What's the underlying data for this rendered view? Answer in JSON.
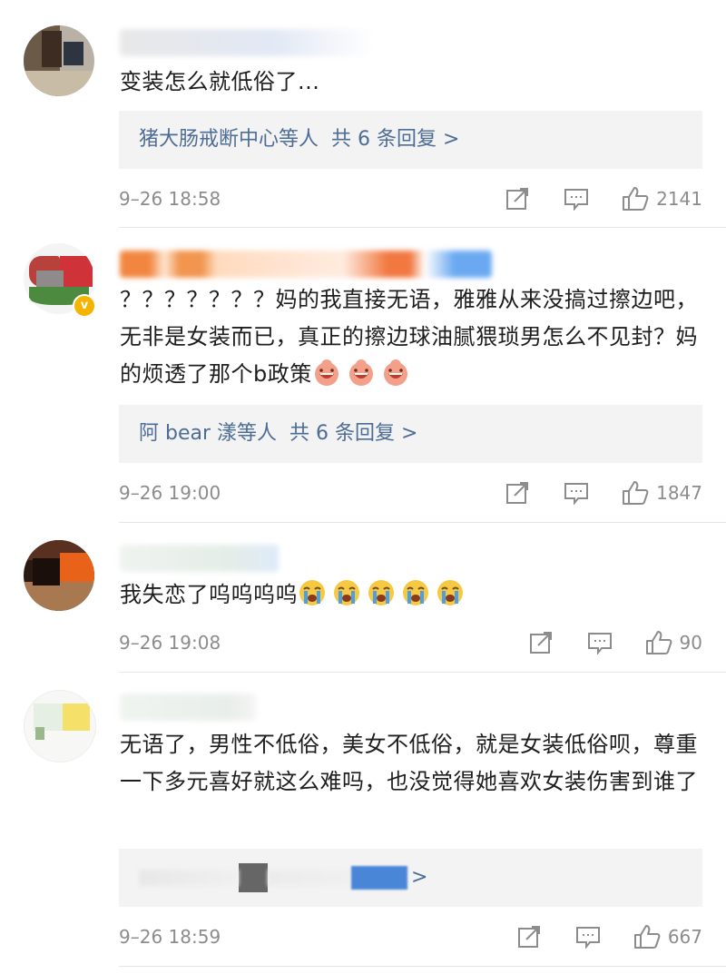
{
  "comments": [
    {
      "text": "变装怎么就低俗了...",
      "replies": {
        "users": "猪大肠戒断中心等人",
        "count": "共 6 条回复 >"
      },
      "time": "9–26 18:58",
      "likes": "2141"
    },
    {
      "text_parts": [
        "？？？？？？？妈的我直接无语，雅雅从来没搞过擦边吧，无非是女装而已，真正的擦边球油腻猥琐男怎么不见封？妈的烦透了那个b政策"
      ],
      "text": "？？？？？？？妈的我直接无语，雅雅从来没搞过擦边吧，无非是女装而已，真正的擦边球油腻猥琐男怎么不见封？妈的烦透了那个b政策",
      "emoji_count": 3,
      "emoji_icon": "grinning-blob-emoji",
      "replies": {
        "users": "阿 bear 漾等人",
        "count": "共 6 条回复 >"
      },
      "time": "9–26 19:00",
      "likes": "1847",
      "verified_badge": "v"
    },
    {
      "text": "我失恋了呜呜呜呜",
      "emoji_count": 5,
      "emoji_icon": "crying-face-emoji",
      "time": "9–26 19:08",
      "likes": "90"
    },
    {
      "text": "无语了，男性不低俗，美女不低俗，就是女装低俗呗，尊重一下多元喜好就这么难吗，也没觉得她喜欢女装伤害到谁了",
      "replies": {
        "count": ">"
      },
      "time": "9–26 18:59",
      "likes": "667"
    }
  ],
  "icons": {
    "share": "share-icon",
    "comment": "comment-icon",
    "like": "thumbs-up-icon"
  },
  "colors": {
    "link": "#4d6c96",
    "meta": "#8c8c8c",
    "reply_bg": "#f3f3f3"
  }
}
